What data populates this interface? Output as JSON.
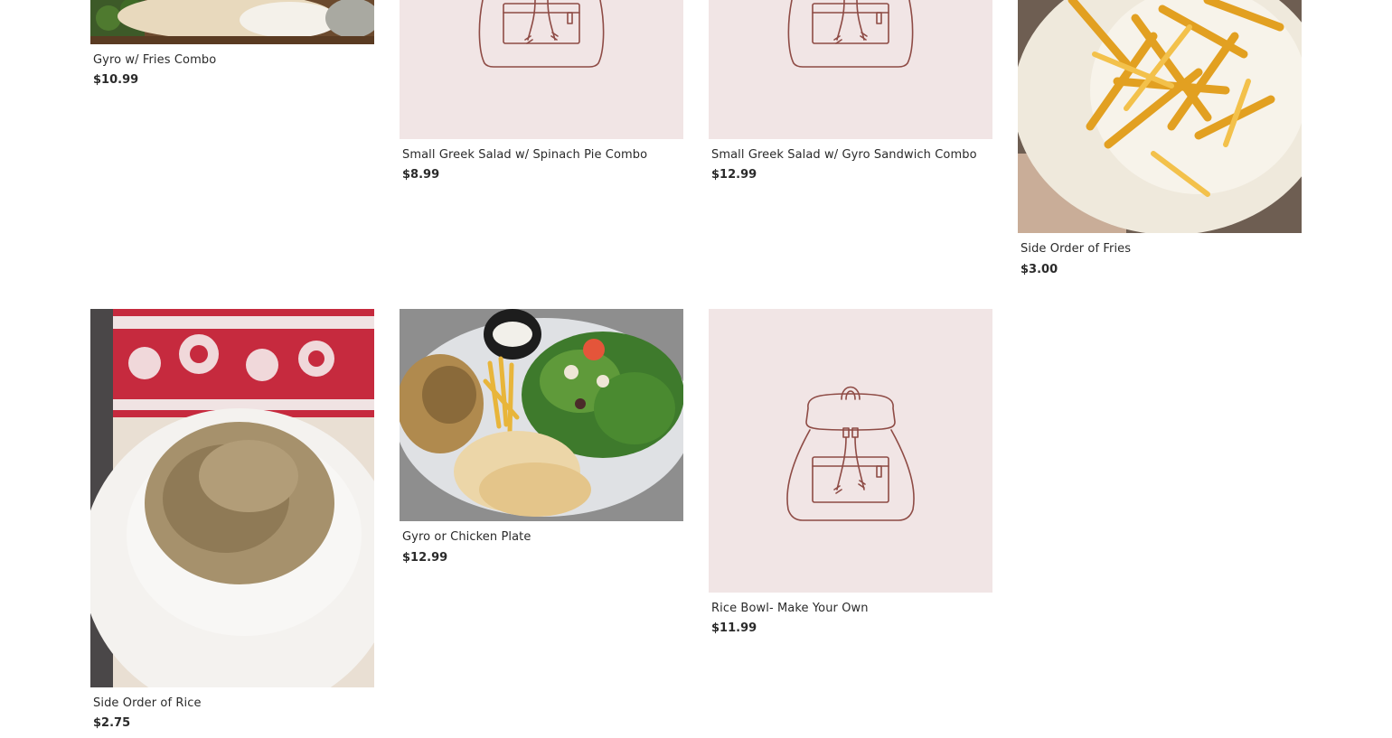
{
  "items": [
    {
      "name": "Gyro w/ Fries Combo",
      "price": "$10.99",
      "image": "gyro-fries-photo"
    },
    {
      "name": "Small Greek Salad w/ Spinach Pie Combo",
      "price": "$8.99",
      "image": "bag-placeholder-icon"
    },
    {
      "name": "Small Greek Salad w/ Gyro Sandwich Combo",
      "price": "$12.99",
      "image": "bag-placeholder-icon"
    },
    {
      "name": "Side Order of Fries",
      "price": "$3.00",
      "image": "fries-photo"
    },
    {
      "name": "Side Order of Rice",
      "price": "$2.75",
      "image": "rice-photo"
    },
    {
      "name": "Gyro or Chicken Plate",
      "price": "$12.99",
      "image": "gyro-plate-photo"
    },
    {
      "name": "Rice Bowl- Make Your Own",
      "price": "$11.99",
      "image": "bag-placeholder-icon"
    }
  ],
  "colors": {
    "placeholder_bg": "#f1e5e5",
    "placeholder_icon": "#8e4b45",
    "text": "#2a2a2a"
  }
}
